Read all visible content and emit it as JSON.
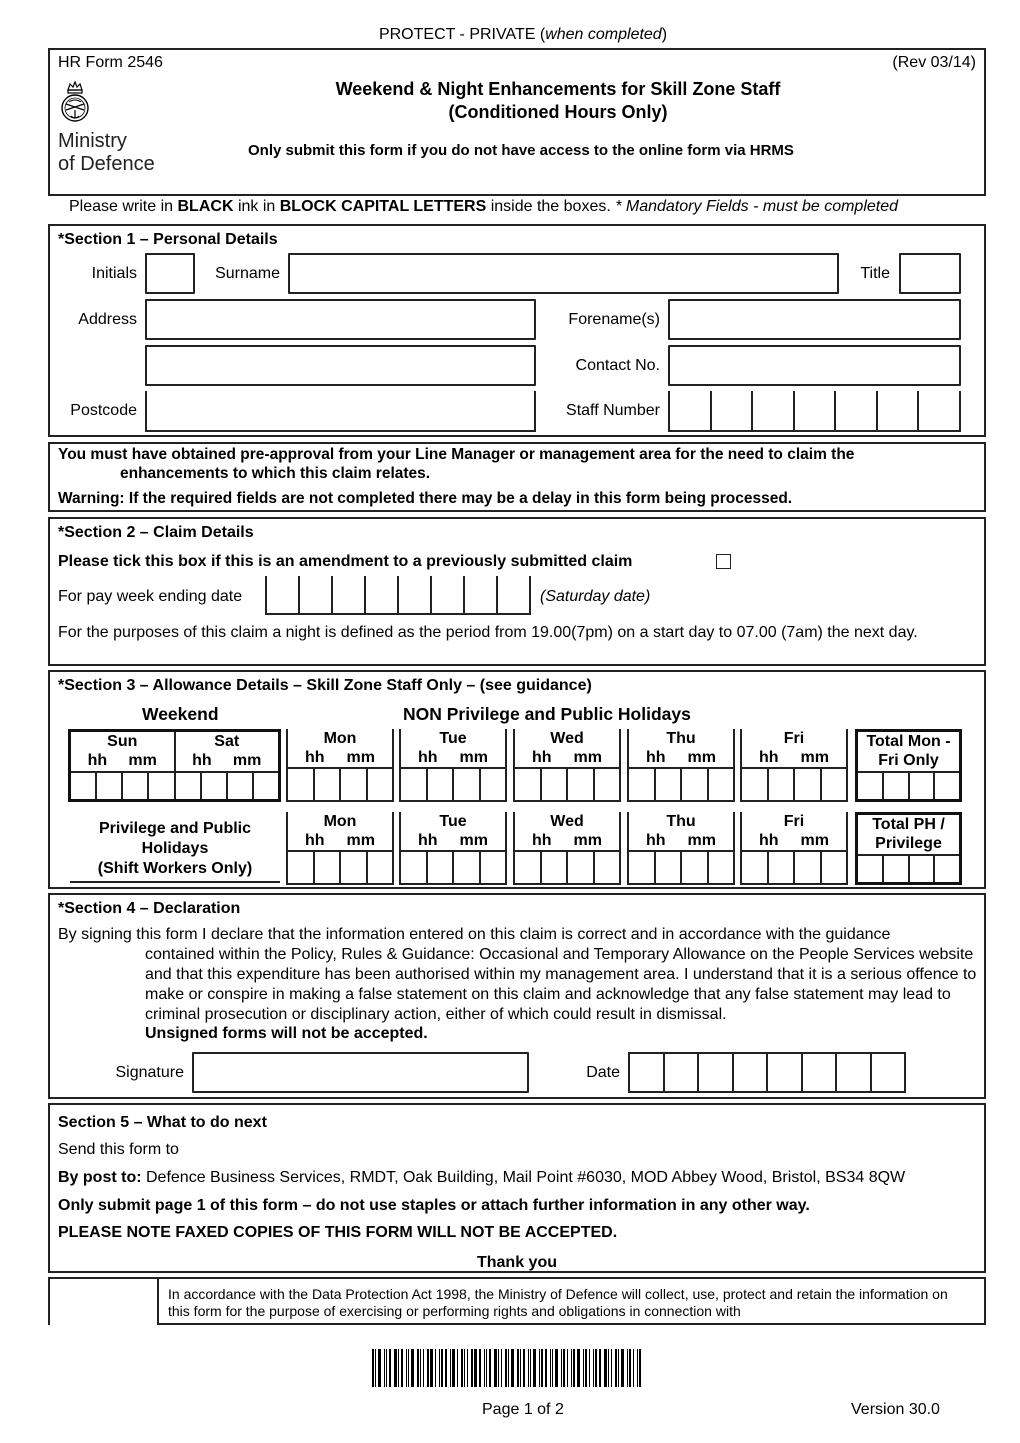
{
  "header": {
    "classification": "PROTECT - PRIVATE (",
    "classification_italic": "when completed",
    "classification_close": ")",
    "form_number": "HR Form 2546",
    "revision": "(Rev 03/14)",
    "title_line1": "Weekend & Night Enhancements for Skill Zone Staff",
    "title_line2": "(Conditioned Hours Only)",
    "subtitle": "Only submit this form if you do not have access to the online form via HRMS",
    "logo_line1": "Ministry",
    "logo_line2": "of Defence",
    "logo_icon": "crest-icon"
  },
  "instructions": {
    "part1": "Please write in ",
    "black": "BLACK",
    "part2": " ink in ",
    "caps": "BLOCK CAPITAL LETTERS",
    "part3": " inside the boxes.  ",
    "mandatory": "* Mandatory Fields - must be completed"
  },
  "section1": {
    "title": "*Section 1 – Personal Details",
    "initials_label": "Initials",
    "surname_label": "Surname",
    "title_label": "Title",
    "address_label": "Address",
    "forenames_label": "Forename(s)",
    "contact_label": "Contact No.",
    "postcode_label": "Postcode",
    "staff_number_label": "Staff Number",
    "staff_number_cells": 7,
    "values": {
      "initials": "",
      "surname": "",
      "title": "",
      "address1": "",
      "address2": "",
      "postcode": "",
      "forenames": "",
      "contact": "",
      "staff_number": ""
    }
  },
  "notice": {
    "line1": "You must have obtained pre-approval from your Line Manager or management area for the need to claim the",
    "line2": "enhancements to which this claim relates.",
    "warning": "Warning: If the required fields are not completed there may be a delay in this form being processed."
  },
  "section2": {
    "title": "*Section 2 – Claim Details",
    "amendment_label": "Please tick this box if this is an amendment to a previously submitted claim",
    "amendment_checked": false,
    "pay_week_label": "For pay week ending date",
    "pay_week_cells": 8,
    "pay_week_hint": "(Saturday date)",
    "night_definition": "For the purposes of this claim a night is defined as the period from 19.00(7pm) on a start day to 07.00 (7am) the next day."
  },
  "section3": {
    "title": "*Section 3 – Allowance Details – Skill Zone Staff Only – (see guidance)",
    "weekend_heading": "Weekend",
    "non_privilege_heading": "NON Privilege and Public Holidays",
    "hh": "hh",
    "mm": "mm",
    "weekend_days": [
      "Sun",
      "Sat"
    ],
    "weekdays": [
      "Mon",
      "Tue",
      "Wed",
      "Thu",
      "Fri"
    ],
    "total_weekday_label": "Total Mon - Fri Only",
    "privilege_label_line1": "Privilege and Public",
    "privilege_label_line2": "Holidays",
    "privilege_label_line3": "(Shift Workers Only)",
    "total_privilege_label": "Total PH / Privilege"
  },
  "section4": {
    "title": "*Section 4 – Declaration",
    "first_line": "By signing this form I declare that the information entered on this claim is correct and in accordance with the guidance",
    "body": "contained within the Policy, Rules & Guidance: Occasional and Temporary Allowance on the People Services website and that this expenditure has been authorised within my management area. I understand that it is a serious offence to make or conspire in making a false statement on this claim and acknowledge that any false statement may lead to criminal prosecution or disciplinary action, either of which could result in dismissal.",
    "unsigned": "Unsigned forms will not be accepted.",
    "signature_label": "Signature",
    "date_label": "Date",
    "date_cells": 8
  },
  "section5": {
    "title": "Section 5 – What to do next",
    "send_to": "Send this form to",
    "post_label": "By post to:",
    "post_address": " Defence Business Services, RMDT, Oak Building, Mail Point #6030, MOD Abbey Wood, Bristol, BS34 8QW",
    "only_page1": "Only submit page 1 of this form – do not use staples or attach further information in any other way.",
    "no_fax": "PLEASE NOTE FAXED COPIES OF THIS FORM WILL NOT BE ACCEPTED.",
    "thanks": "Thank you"
  },
  "data_protection": {
    "text": "In accordance with the Data Protection Act 1998, the Ministry of Defence will collect, use, protect and retain the information on this form for the purpose of exercising or performing rights and obligations in connection with"
  },
  "footer": {
    "page": "Page 1 of 2",
    "version": "Version 30.0",
    "barcode_icon": "barcode-icon"
  }
}
